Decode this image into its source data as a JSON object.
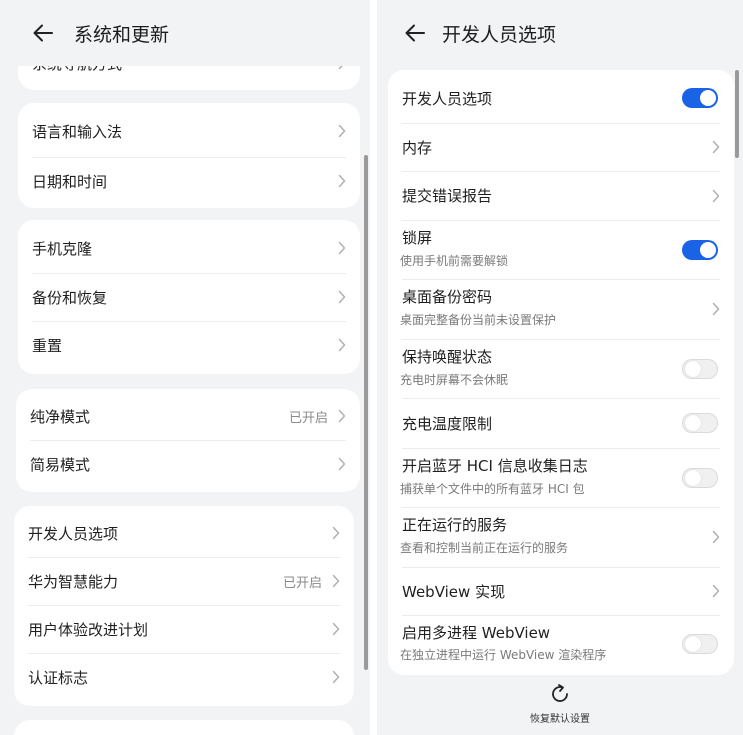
{
  "left": {
    "title": "系统和更新",
    "partial_item": "系统导航方式",
    "groups": [
      [
        {
          "label": "语言和输入法"
        },
        {
          "label": "日期和时间"
        }
      ],
      [
        {
          "label": "手机克隆"
        },
        {
          "label": "备份和恢复"
        },
        {
          "label": "重置"
        }
      ],
      [
        {
          "label": "纯净模式",
          "status": "已开启"
        },
        {
          "label": "简易模式"
        }
      ],
      [
        {
          "label": "开发人员选项"
        },
        {
          "label": "华为智慧能力",
          "status": "已开启"
        },
        {
          "label": "用户体验改进计划"
        },
        {
          "label": "认证标志"
        }
      ]
    ]
  },
  "right": {
    "title": "开发人员选项",
    "items": [
      {
        "label": "开发人员选项",
        "control": "toggle",
        "on": true
      },
      {
        "label": "内存",
        "control": "chevron"
      },
      {
        "label": "提交错误报告",
        "control": "chevron"
      },
      {
        "label": "锁屏",
        "sub": "使用手机前需要解锁",
        "control": "toggle",
        "on": true
      },
      {
        "label": "桌面备份密码",
        "sub": "桌面完整备份当前未设置保护",
        "control": "chevron"
      },
      {
        "label": "保持唤醒状态",
        "sub": "充电时屏幕不会休眠",
        "control": "toggle",
        "on": false
      },
      {
        "label": "充电温度限制",
        "control": "toggle",
        "on": false
      },
      {
        "label": "开启蓝牙 HCI 信息收集日志",
        "sub": "捕获单个文件中的所有蓝牙 HCI 包",
        "control": "toggle",
        "on": false
      },
      {
        "label": "正在运行的服务",
        "sub": "查看和控制当前正在运行的服务",
        "control": "chevron"
      },
      {
        "label": "WebView 实现",
        "control": "chevron"
      },
      {
        "label": "启用多进程 WebView",
        "sub": "在独立进程中运行 WebView 渲染程序",
        "control": "toggle",
        "on": false
      }
    ],
    "reset_label": "恢复默认设置"
  },
  "colors": {
    "accent": "#1a63e6",
    "background": "#f1f3f5",
    "card": "#ffffff"
  },
  "icons": {
    "back": "arrow-left-icon",
    "chevron": "chevron-right-icon",
    "reset": "refresh-icon"
  }
}
